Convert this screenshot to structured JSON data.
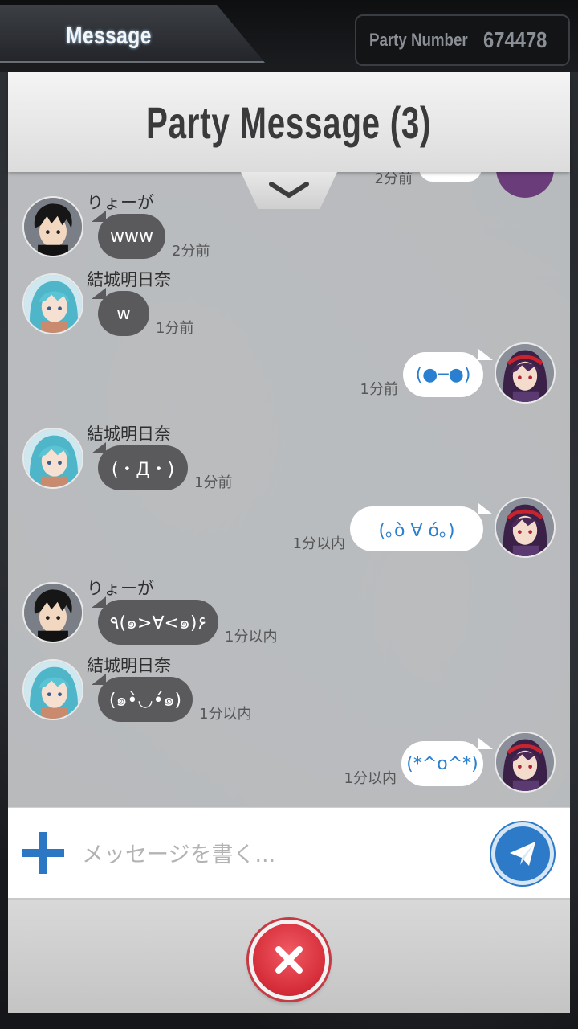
{
  "top_bar": {
    "tab_label": "Message",
    "party_number_label": "Party Number",
    "party_number_value": "674478"
  },
  "modal": {
    "title": "Party Message (3)",
    "collapse_icon": "chevron-down-icon"
  },
  "peek": {
    "time": "2分前"
  },
  "messages": [
    {
      "side": "left",
      "sender": "りょーが",
      "text": "www",
      "time": "2分前",
      "avatar": "kirito"
    },
    {
      "side": "left",
      "sender": "結城明日奈",
      "text": "w",
      "time": "1分前",
      "avatar": "asuna"
    },
    {
      "side": "right",
      "text": "(●─●)",
      "time": "1分前",
      "avatar": "yuuki"
    },
    {
      "side": "left",
      "sender": "結城明日奈",
      "text": "(・Д・)",
      "time": "1分前",
      "avatar": "asuna"
    },
    {
      "side": "right",
      "text": "(｡ò ∀ ó｡)",
      "time": "1分以内",
      "avatar": "yuuki"
    },
    {
      "side": "left",
      "sender": "りょーが",
      "text": "٩(๑>∀<๑)۶",
      "time": "1分以内",
      "avatar": "kirito"
    },
    {
      "side": "left",
      "sender": "結城明日奈",
      "text": "(๑•̀◡•́๑)",
      "time": "1分以内",
      "avatar": "asuna"
    },
    {
      "side": "right",
      "text": "(*^o^*)",
      "time": "1分以内",
      "avatar": "yuuki"
    }
  ],
  "input": {
    "placeholder": "メッセージを書く...",
    "add_icon": "plus-icon",
    "send_icon": "paper-plane-icon"
  },
  "footer": {
    "close_icon": "close-icon"
  },
  "colors": {
    "accent_blue": "#2d7ac8",
    "close_red": "#d42c38",
    "bubble_dark": "#5a5a5c",
    "bubble_light": "#ffffff",
    "emoticon_blue": "#2a7fd0"
  }
}
